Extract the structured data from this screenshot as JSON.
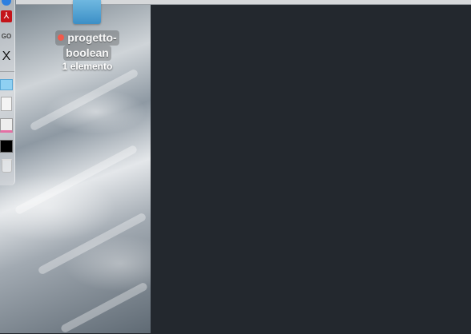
{
  "desktop": {
    "folder": {
      "name_line1": "progetto-",
      "name_line2": "boolean",
      "item_count": "1 elemento",
      "tag_color": "#f25a4b"
    }
  },
  "dock": {
    "items": [
      {
        "icon": "safari-icon"
      },
      {
        "icon": "acrobat-reader-icon"
      },
      {
        "icon": "go-app-icon",
        "glyph": "GO"
      },
      {
        "icon": "x-icon",
        "glyph": "X"
      },
      {
        "icon": "mail-icon"
      },
      {
        "icon": "document-icon"
      },
      {
        "icon": "preview-icon"
      },
      {
        "icon": "terminal-icon"
      },
      {
        "icon": "trash-icon"
      }
    ]
  },
  "colors": {
    "window_bg": "#23282e",
    "accent_folder": "#4aa3d6"
  }
}
